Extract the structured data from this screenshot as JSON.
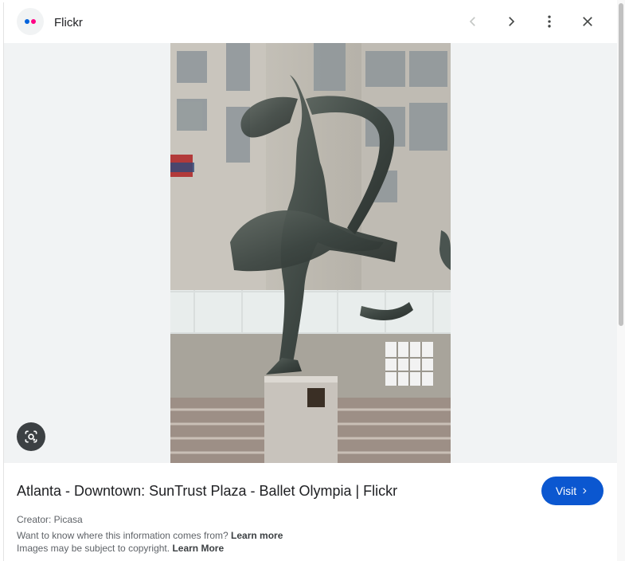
{
  "header": {
    "site_name": "Flickr",
    "favicon_colors": [
      "#0063dc",
      "#ff0084"
    ],
    "icons": [
      "back-chevron-icon",
      "forward-chevron-icon",
      "more-vert-icon",
      "close-icon"
    ]
  },
  "image": {
    "subject": "bronze dancer sculpture photo",
    "lens_button_icon": "lens-search-icon"
  },
  "result": {
    "title": "Atlanta - Downtown: SunTrust Plaza - Ballet Olympia | Flickr",
    "visit_label": "Visit",
    "creator": "Creator: Picasa",
    "info_text": "Want to know where this information comes from?",
    "info_link": "Learn more",
    "copyright_text": "Images may be subject to copyright.",
    "copyright_link": "Learn More"
  },
  "colors": {
    "accent": "#0b57d0",
    "viewer_bg": "#f1f3f4"
  }
}
